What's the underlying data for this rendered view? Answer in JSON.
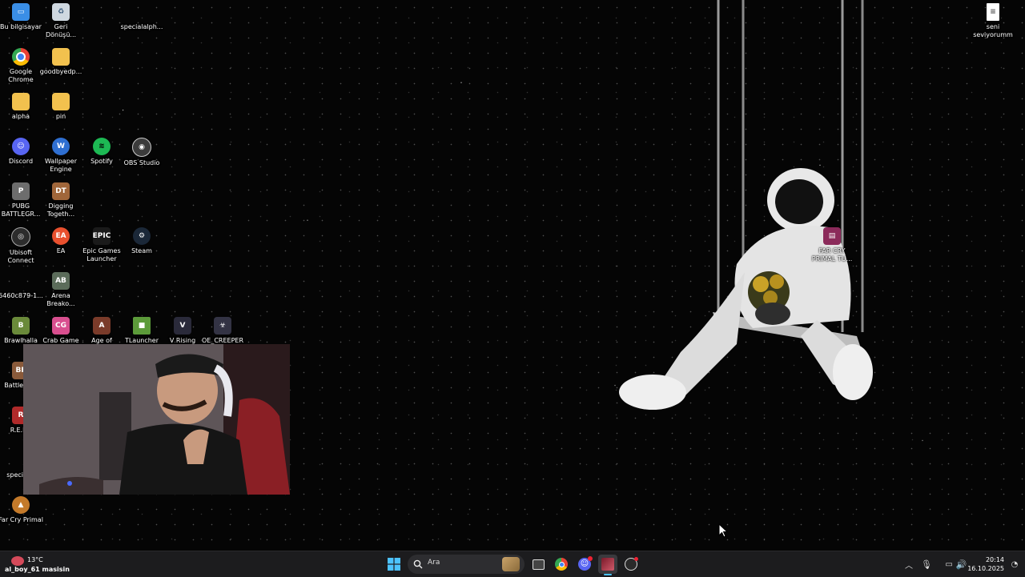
{
  "desktop_icons": [
    {
      "label": "Bu bilgisayar",
      "icon": "computer-icon",
      "color": "#3a8ee6"
    },
    {
      "label": "Geri Dönüşü...",
      "icon": "recycle-bin-icon",
      "color": "#cfd8e0"
    },
    {
      "label": "specialalph...",
      "icon": "file-icon",
      "color": "#000000"
    },
    {
      "label": "Google Chrome",
      "icon": "chrome-icon",
      "color": "#e04b3c"
    },
    {
      "label": "goodbyedp...",
      "icon": "folder-icon",
      "color": "#f2c14e"
    },
    {
      "label": "alpha",
      "icon": "folder-icon",
      "color": "#f2c14e"
    },
    {
      "label": "pin",
      "icon": "folder-icon",
      "color": "#f2c14e"
    },
    {
      "label": "Discord",
      "icon": "discord-icon",
      "color": "#5865f2"
    },
    {
      "label": "Wallpaper Engine",
      "icon": "wallpaper-engine-icon",
      "color": "#2f6fd1"
    },
    {
      "label": "Spotify",
      "icon": "spotify-icon",
      "color": "#1db954"
    },
    {
      "label": "OBS Studio",
      "icon": "obs-icon",
      "color": "#3b3b3b"
    },
    {
      "label": "PUBG BATTLEGR...",
      "icon": "pubg-icon",
      "color": "#6d6d6d"
    },
    {
      "label": "Digging Togeth...",
      "icon": "game-icon",
      "color": "#a0663a"
    },
    {
      "label": "Ubisoft Connect",
      "icon": "ubisoft-icon",
      "color": "#2c2c2c"
    },
    {
      "label": "EA",
      "icon": "ea-icon",
      "color": "#e9502e"
    },
    {
      "label": "Epic Games Launcher",
      "icon": "epic-games-icon",
      "color": "#1a1a1a"
    },
    {
      "label": "Steam",
      "icon": "steam-icon",
      "color": "#1b2838"
    },
    {
      "label": "6460c879-1...",
      "icon": "file-icon",
      "color": "#000000"
    },
    {
      "label": "Arena Breako...",
      "icon": "game-icon",
      "color": "#5b6c5a"
    },
    {
      "label": "Brawlhalla",
      "icon": "game-icon",
      "color": "#6a8a3a"
    },
    {
      "label": "Crab Game",
      "icon": "game-icon",
      "color": "#d94f8f"
    },
    {
      "label": "Age of",
      "icon": "game-icon",
      "color": "#7a3b2a"
    },
    {
      "label": "TLauncher",
      "icon": "minecraft-icon",
      "color": "#5c9b3a"
    },
    {
      "label": "V Rising",
      "icon": "game-icon",
      "color": "#2a2a3a"
    },
    {
      "label": "OE_CREEPER",
      "icon": "game-icon",
      "color": "#333344"
    },
    {
      "label": "Battlefie...",
      "icon": "game-icon",
      "color": "#8a5a3a"
    },
    {
      "label": "R.E.P...",
      "icon": "game-icon",
      "color": "#b02a2a"
    },
    {
      "label": "special...",
      "icon": "file-icon",
      "color": "#000000"
    },
    {
      "label": "Far Cry Primal",
      "icon": "far-cry-icon",
      "color": "#c47a2a"
    },
    {
      "label": "FAR CRY PRIMAL TU...",
      "icon": "winrar-icon",
      "color": "#8b2a5a"
    },
    {
      "label": "seni seviyorumm",
      "icon": "text-file-icon",
      "color": "#ffffff"
    }
  ],
  "taskbar": {
    "weather_temp": "13°C",
    "weather_desc": "al_boy_61 masisin",
    "search_placeholder": "Ara",
    "time": "20:14",
    "date": "16.10.2025"
  }
}
